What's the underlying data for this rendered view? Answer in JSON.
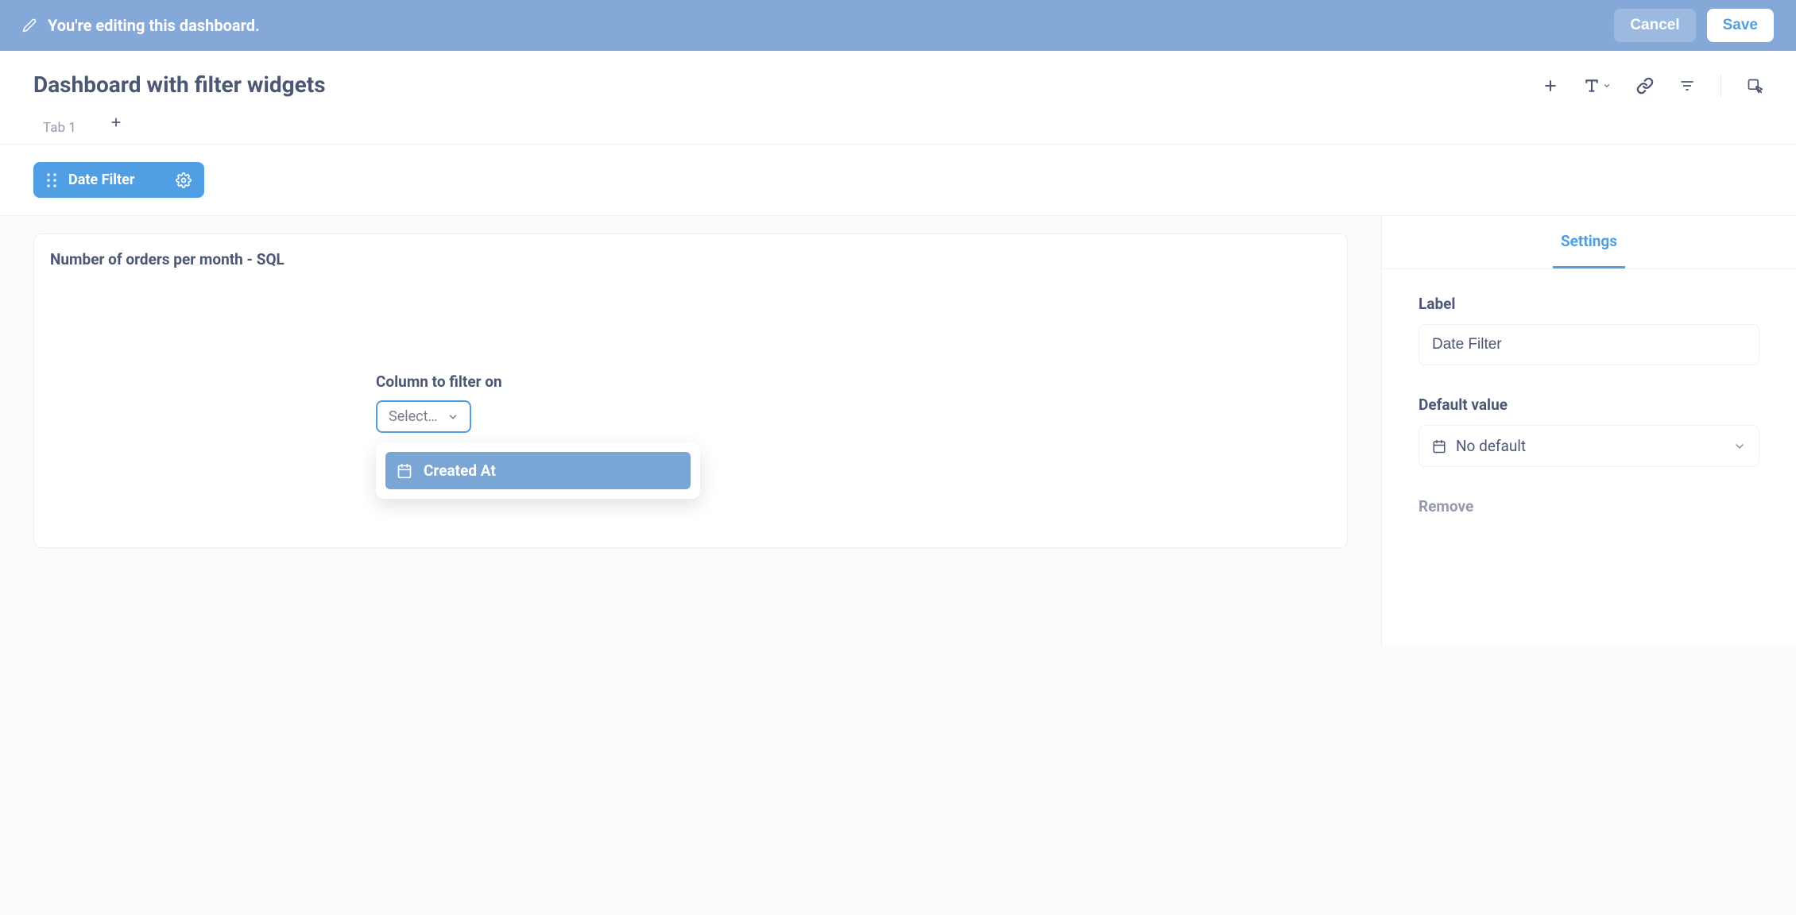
{
  "banner": {
    "text": "You're editing this dashboard.",
    "cancel": "Cancel",
    "save": "Save"
  },
  "dashboard": {
    "title": "Dashboard with filter widgets"
  },
  "tabs": {
    "items": [
      "Tab 1"
    ]
  },
  "filters": {
    "chip_label": "Date Filter"
  },
  "card": {
    "title": "Number of orders per month - SQL",
    "column_label": "Column to filter on",
    "select_placeholder": "Select…",
    "dropdown_options": [
      "Created At"
    ]
  },
  "sidebar": {
    "tab": "Settings",
    "label_heading": "Label",
    "label_value": "Date Filter",
    "default_heading": "Default value",
    "default_value": "No default",
    "remove": "Remove"
  }
}
